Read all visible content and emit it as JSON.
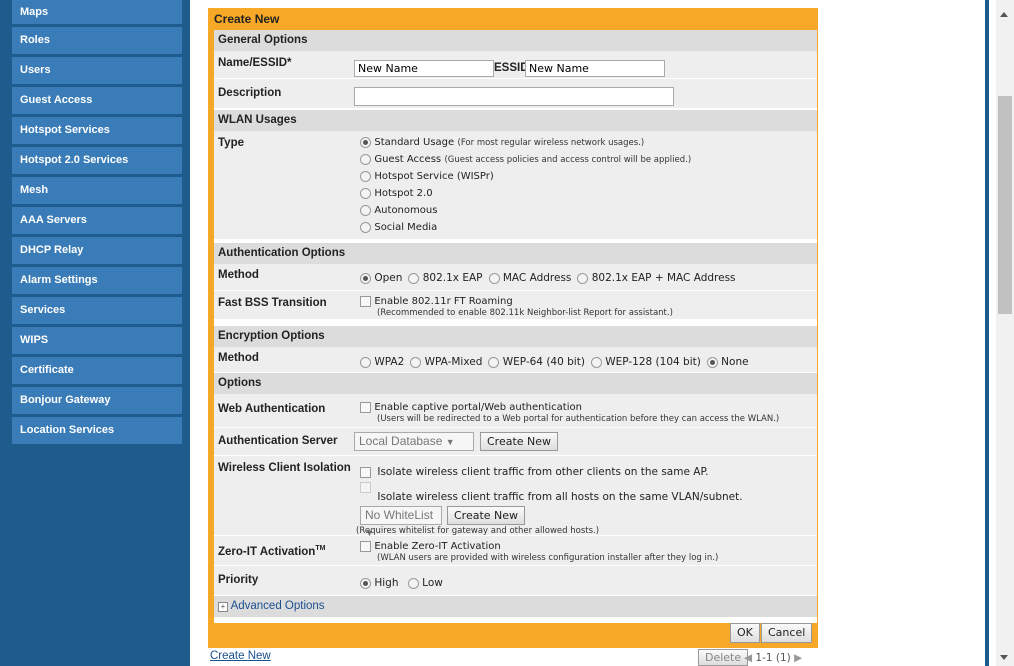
{
  "sidebar": {
    "items": [
      "Maps",
      "Roles",
      "Users",
      "Guest Access",
      "Hotspot Services",
      "Hotspot 2.0 Services",
      "Mesh",
      "AAA Servers",
      "DHCP Relay",
      "Alarm Settings",
      "Services",
      "WIPS",
      "Certificate",
      "Bonjour Gateway",
      "Location Services"
    ]
  },
  "panel": {
    "title": "Create New",
    "general": {
      "header": "General Options",
      "name_label": "Name/ESSID*",
      "name_value": "New Name",
      "essid_label": "ESSID",
      "essid_value": "New Name",
      "desc_label": "Description",
      "desc_value": ""
    },
    "wlan": {
      "header": "WLAN Usages",
      "type_label": "Type",
      "types": [
        {
          "label": "Standard Usage",
          "note": "(For most regular wireless network usages.)",
          "selected": true
        },
        {
          "label": "Guest Access",
          "note": "(Guest access policies and access control will be applied.)",
          "selected": false
        },
        {
          "label": "Hotspot Service (WISPr)",
          "note": "",
          "selected": false
        },
        {
          "label": "Hotspot 2.0",
          "note": "",
          "selected": false
        },
        {
          "label": "Autonomous",
          "note": "",
          "selected": false
        },
        {
          "label": "Social Media",
          "note": "",
          "selected": false
        }
      ]
    },
    "auth": {
      "header": "Authentication Options",
      "method_label": "Method",
      "methods": [
        {
          "label": "Open",
          "selected": true
        },
        {
          "label": "802.1x EAP",
          "selected": false
        },
        {
          "label": "MAC Address",
          "selected": false
        },
        {
          "label": "802.1x EAP + MAC Address",
          "selected": false
        }
      ],
      "fbt_label": "Fast BSS Transition",
      "fbt_check": "Enable 802.11r FT Roaming",
      "fbt_note": "(Recommended to enable 802.11k Neighbor-list Report for assistant.)"
    },
    "enc": {
      "header": "Encryption Options",
      "method_label": "Method",
      "methods": [
        {
          "label": "WPA2",
          "selected": false
        },
        {
          "label": "WPA-Mixed",
          "selected": false
        },
        {
          "label": "WEP-64 (40 bit)",
          "selected": false
        },
        {
          "label": "WEP-128 (104 bit)",
          "selected": false
        },
        {
          "label": "None",
          "selected": true
        }
      ]
    },
    "options": {
      "header": "Options",
      "webauth_label": "Web Authentication",
      "webauth_check": "Enable captive portal/Web authentication",
      "webauth_note": "(Users will be redirected to a Web portal for authentication before they can access the WLAN.)",
      "authserver_label": "Authentication Server",
      "authserver_value": "Local Database",
      "create_new": "Create New",
      "isolation_label": "Wireless Client Isolation",
      "isolation_check1": "Isolate wireless client traffic from other clients on the same AP.",
      "isolation_check2": "Isolate wireless client traffic from all hosts on the same VLAN/subnet.",
      "whitelist_value": "No WhiteList",
      "whitelist_note": "(Requires whitelist for gateway and other allowed hosts.)",
      "zeroit_label": "Zero-IT Activation",
      "zeroit_tm": "TM",
      "zeroit_check": "Enable Zero-IT Activation",
      "zeroit_note": "(WLAN users are provided with wireless configuration installer after they log in.)",
      "priority_label": "Priority",
      "priority_high": "High",
      "priority_low": "Low",
      "advanced": "Advanced Options"
    },
    "ok": "OK",
    "cancel": "Cancel"
  },
  "footer": {
    "create_new": "Create New",
    "delete": "Delete",
    "pager": "1-1 (1)"
  },
  "colors": {
    "sidebar": "#1f5c8e",
    "nav_item": "#3a7cb8",
    "panel": "#f7a827"
  }
}
